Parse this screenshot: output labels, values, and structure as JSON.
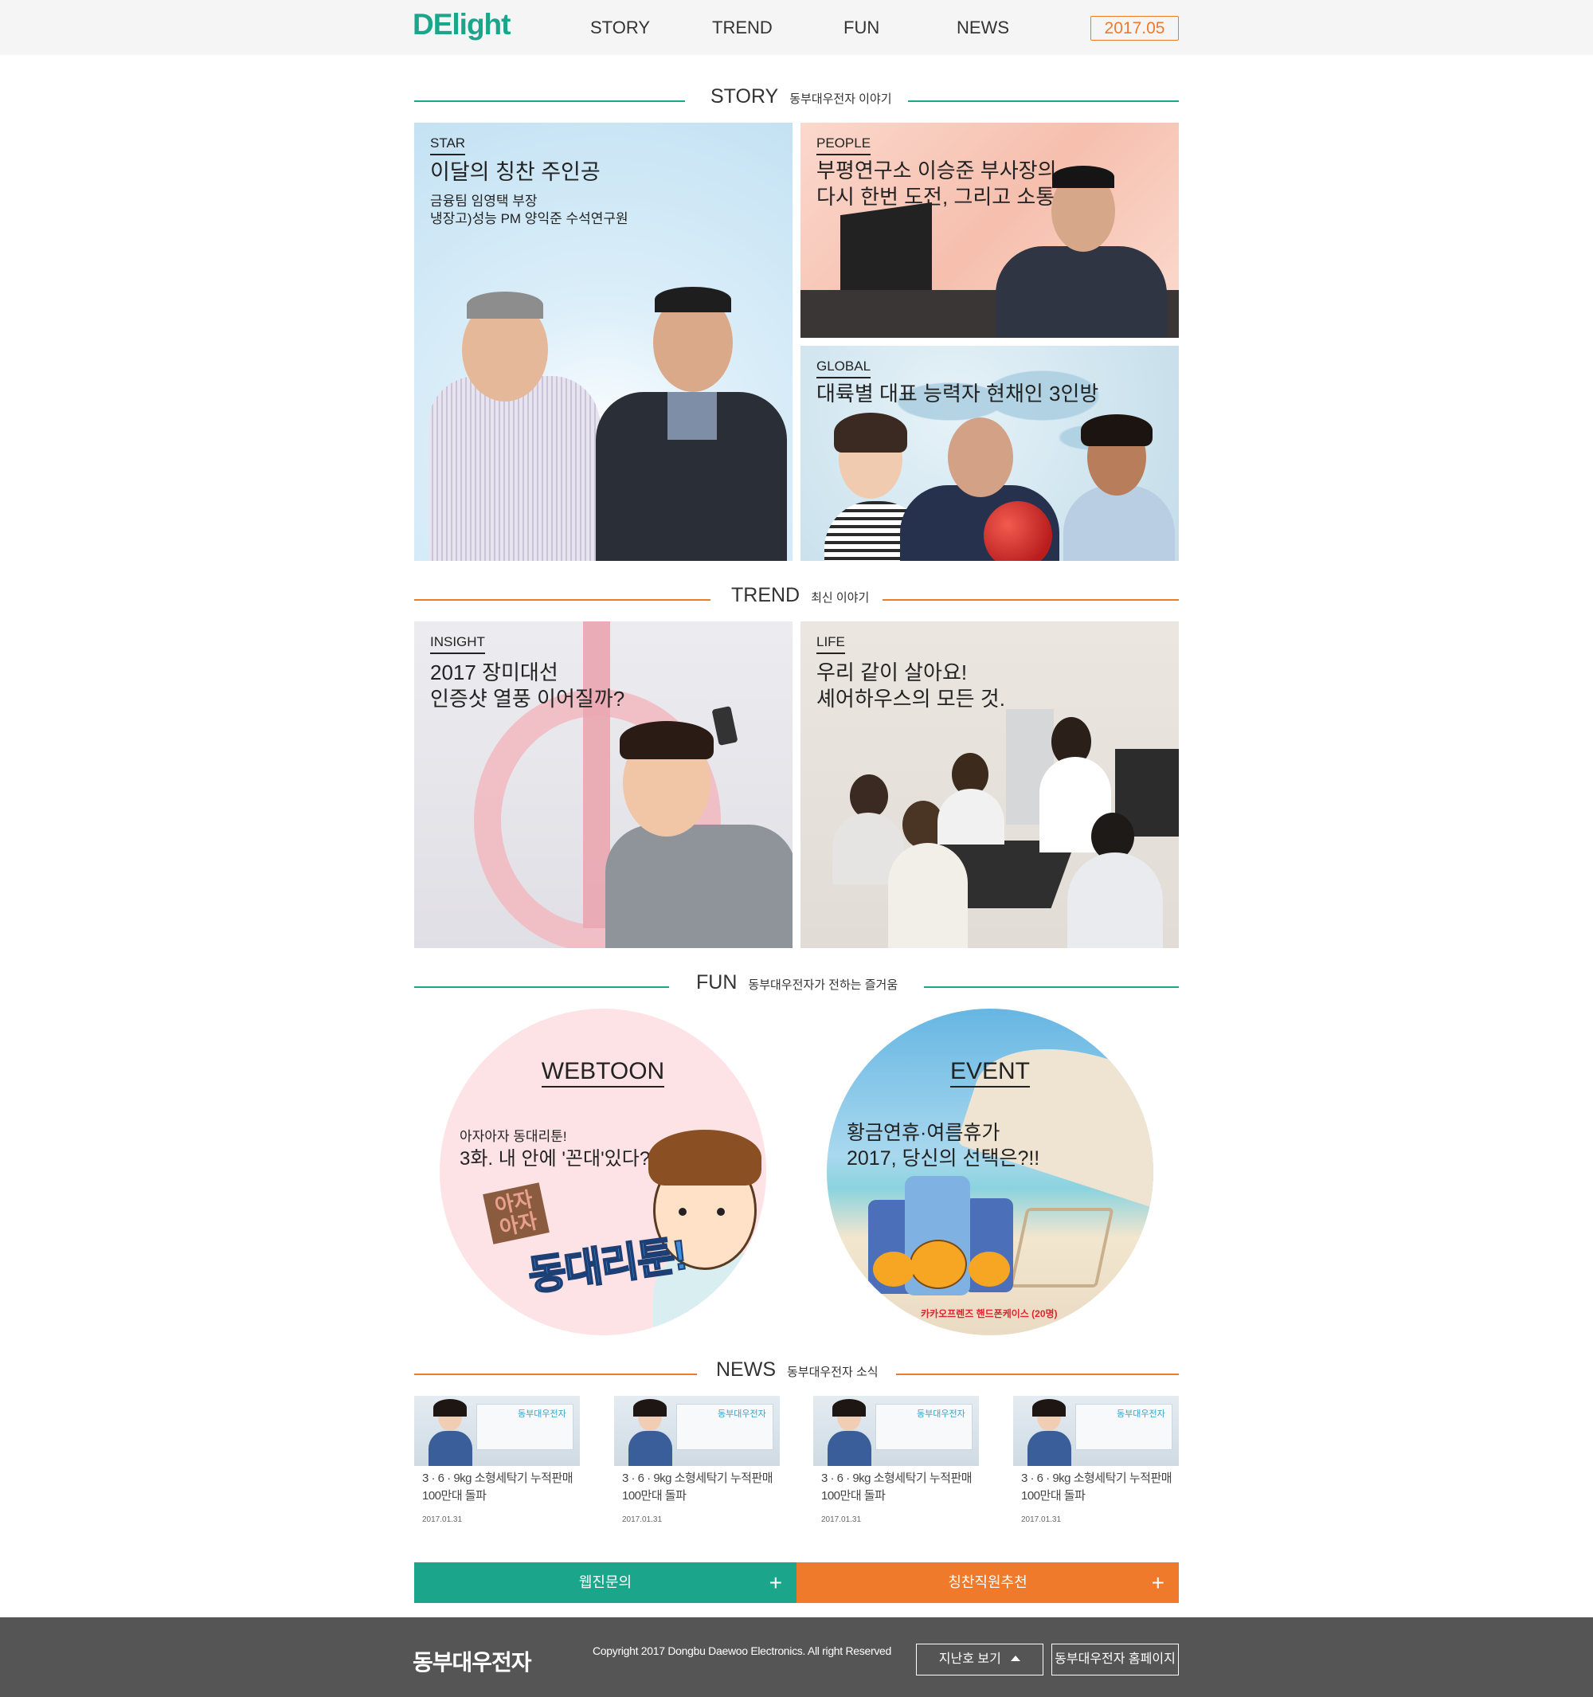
{
  "header": {
    "logo": "DElight",
    "nav": [
      "STORY",
      "TREND",
      "FUN",
      "NEWS"
    ],
    "issue": "2017.05"
  },
  "sections": {
    "story": {
      "title": "STORY",
      "subtitle": "동부대우전자 이야기"
    },
    "trend": {
      "title": "TREND",
      "subtitle": "최신 이야기"
    },
    "fun": {
      "title": "FUN",
      "subtitle": "동부대우전자가 전하는 즐거움"
    },
    "news": {
      "title": "NEWS",
      "subtitle": "동부대우전자 소식"
    }
  },
  "story": {
    "star": {
      "category": "STAR",
      "headline": "이달의 칭찬 주인공",
      "sub": "금융팀 임영택 부장\n냉장고)성능 PM 양익준 수석연구원"
    },
    "people": {
      "category": "PEOPLE",
      "headline": "부평연구소 이승준 부사장의\n다시 한번 도전, 그리고 소통"
    },
    "global": {
      "category": "GLOBAL",
      "headline": "대륙별 대표 능력자 현채인 3인방"
    }
  },
  "trend": {
    "insight": {
      "category": "INSIGHT",
      "headline": "2017 장미대선\n인증샷 열풍 이어질까?"
    },
    "life": {
      "category": "LIFE",
      "headline": "우리 같이 살아요!\n셰어하우스의 모든 것."
    }
  },
  "fun": {
    "webtoon": {
      "title": "WEBTOON",
      "line1": "아자아자 동대리툰!",
      "line2": "3화. 내 안에 '꼰대'있다?!",
      "logo_text": "동대리툰!",
      "logo_small": "아자아자"
    },
    "event": {
      "title": "EVENT",
      "line1": "황금연휴·여름휴가",
      "line2": "2017, 당신의 선택은?!!",
      "prize": "카카오프렌즈 핸드폰케이스 (20명)"
    }
  },
  "news": {
    "thumb_brand": "동부대우전자",
    "items": [
      {
        "title": "3 · 6 · 9kg 소형세탁기 누적판매\n100만대 돌파",
        "date": "2017.01.31"
      },
      {
        "title": "3 · 6 · 9kg 소형세탁기 누적판매\n100만대 돌파",
        "date": "2017.01.31"
      },
      {
        "title": "3 · 6 · 9kg 소형세탁기 누적판매\n100만대 돌파",
        "date": "2017.01.31"
      },
      {
        "title": "3 · 6 · 9kg 소형세탁기 누적판매\n100만대 돌파",
        "date": "2017.01.31"
      }
    ]
  },
  "actions": {
    "inquiry": "웹진문의",
    "recommend": "칭찬직원추천",
    "plus": "+"
  },
  "footer": {
    "logo": "동부대우전자",
    "copyright": "Copyright 2017 Dongbu Daewoo Electronics. All right Reserved",
    "past_issues": "지난호 보기",
    "homepage": "동부대우전자 홈페이지"
  },
  "colors": {
    "teal": "#1ba68c",
    "orange": "#f07a2b",
    "footer": "#555555",
    "header": "#f5f5f5"
  }
}
